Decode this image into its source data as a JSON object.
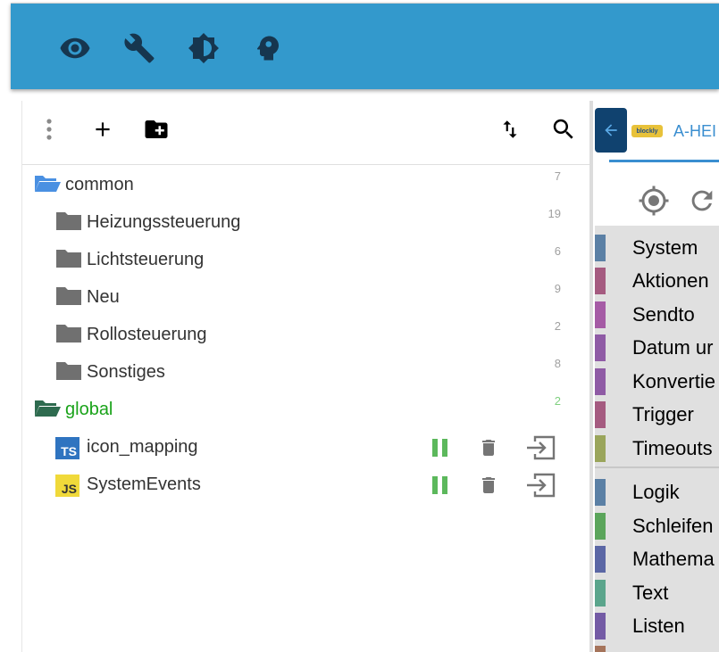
{
  "appbar": {
    "tools": [
      {
        "name": "eye-icon"
      },
      {
        "name": "wrench-icon"
      },
      {
        "name": "brightness-icon"
      },
      {
        "name": "head-icon"
      }
    ],
    "color": "#3399cc"
  },
  "toolbar": {
    "menu_icon": "more-vert-icon",
    "add_icon": "plus-icon",
    "add_folder_icon": "folder-plus-icon",
    "sort_icon": "sort-icon",
    "search_icon": "search-icon"
  },
  "tree": [
    {
      "label": "common",
      "count": "7",
      "type": "folder-open",
      "level": 0,
      "color": "#4a90e2"
    },
    {
      "label": "Heizungssteuerung",
      "count": "19",
      "type": "folder",
      "level": 1
    },
    {
      "label": "Lichtsteuerung",
      "count": "6",
      "type": "folder",
      "level": 1
    },
    {
      "label": "Neu",
      "count": "9",
      "type": "folder",
      "level": 1
    },
    {
      "label": "Rollosteuerung",
      "count": "2",
      "type": "folder",
      "level": 1
    },
    {
      "label": "Sonstiges",
      "count": "8",
      "type": "folder",
      "level": 1
    },
    {
      "label": "global",
      "count": "2",
      "type": "folder-open-global",
      "level": 0,
      "color": "#2e6b4f"
    },
    {
      "label": "icon_mapping",
      "type": "script-ts",
      "badge": "TS",
      "level": 1
    },
    {
      "label": "SystemEvents",
      "type": "script-js",
      "badge": "JS",
      "level": 1
    }
  ],
  "script_actions": {
    "pause_color": "#5cb85c",
    "delete_color": "#757575",
    "export_color": "#757575"
  },
  "editor": {
    "logo_text": "blockly",
    "tab_label": "A-HEI",
    "toolbox_categories": [
      {
        "name": "System",
        "color": "#5b80a5"
      },
      {
        "name": "Aktionen",
        "color": "#a55b80"
      },
      {
        "name": "Sendto",
        "color": "#a55ba5"
      },
      {
        "name": "Datum ur",
        "color": "#8f5ba5"
      },
      {
        "name": "Konvertie",
        "color": "#8f5ba5"
      },
      {
        "name": "Trigger",
        "color": "#a55b80"
      },
      {
        "name": "Timeouts",
        "color": "#9aa55b"
      },
      {
        "name": "Logik",
        "color": "#5b80a5"
      },
      {
        "name": "Schleifen",
        "color": "#5ba55b"
      },
      {
        "name": "Mathema",
        "color": "#5b67a5"
      },
      {
        "name": "Text",
        "color": "#5ba58c"
      },
      {
        "name": "Listen",
        "color": "#745ba5"
      }
    ]
  }
}
